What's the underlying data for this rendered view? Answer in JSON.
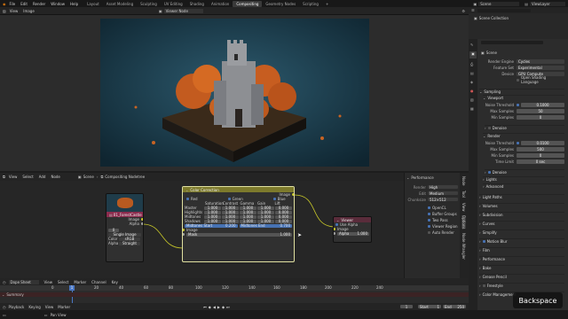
{
  "topbar": {
    "menus": [
      "File",
      "Edit",
      "Render",
      "Window",
      "Help"
    ],
    "workspaces": [
      "Layout",
      "Asset Modeling",
      "Sculpting",
      "UV Editing",
      "Shading",
      "Animation",
      "Compositing",
      "Geometry Nodes",
      "Scripting"
    ],
    "active_workspace": "Compositing",
    "scene": "Scene",
    "view_layer": "ViewLayer"
  },
  "viewer": {
    "menus": [
      "View",
      "Image"
    ],
    "image_name": "Viewer Node"
  },
  "node_editor": {
    "breadcrumb_scene": "Scene",
    "breadcrumb_tree": "Compositing Nodetree",
    "menus": [
      "View",
      "Select",
      "Add",
      "Node"
    ],
    "image_node": {
      "filename": "01_ForestCastle",
      "frame": "0",
      "source": "Single Image",
      "color_label": "Color",
      "color_value": "sRGB",
      "alpha_label": "Alpha",
      "alpha_value": "Straight",
      "out_image": "Image",
      "out_alpha": "Alpha"
    },
    "cc_node": {
      "title": "Color Correction",
      "channels": [
        "Red",
        "Green",
        "Blue"
      ],
      "columns": [
        "Saturation",
        "Contrast",
        "Gamma",
        "Gain",
        "Lift"
      ],
      "rows": [
        {
          "label": "Master",
          "values": [
            "1.000",
            "1.000",
            "1.000",
            "1.000",
            "0.000"
          ]
        },
        {
          "label": "Highlights",
          "values": [
            "1.000",
            "1.000",
            "1.000",
            "1.000",
            "0.000"
          ]
        },
        {
          "label": "Midtones",
          "values": [
            "1.000",
            "1.000",
            "1.000",
            "1.000",
            "0.000"
          ]
        },
        {
          "label": "Shadows",
          "values": [
            "1.000",
            "1.000",
            "1.000",
            "1.000",
            "0.000"
          ]
        }
      ],
      "midtones_start": "Midtones Start",
      "midtones_start_value": "0.200",
      "midtones_end": "Midtones End",
      "midtones_end_value": "0.700",
      "out_image": "Image",
      "in_image": "Image",
      "in_mask": "Mask",
      "mask_value": "1.000"
    },
    "viewer_node": {
      "title": "Viewer",
      "use_alpha": "Use Alpha",
      "in_image": "Image",
      "in_alpha": "Alpha",
      "alpha_value": "1.000"
    },
    "performance": {
      "title": "Performance",
      "render_label": "Render",
      "render_value": "High",
      "edit_label": "Edit",
      "edit_value": "Medium",
      "chunksize_label": "Chunksize",
      "chunksize_value": "512×512",
      "options": [
        "OpenCL",
        "Buffer Groups",
        "Two Pass",
        "Viewer Region",
        "Auto Render"
      ]
    },
    "tabs": [
      "Node",
      "Tool",
      "View",
      "Options",
      "Node Wrangler"
    ]
  },
  "timeline": {
    "editor": "Dope Sheet",
    "menus": [
      "View",
      "Select",
      "Marker",
      "Channel",
      "Key"
    ],
    "current_frame": "1",
    "ticks": [
      "0",
      "20",
      "40",
      "60",
      "80",
      "100",
      "120",
      "140",
      "160",
      "180",
      "200",
      "220",
      "240"
    ],
    "summary": "Summary",
    "playback": "Playback",
    "keying": "Keying",
    "view": "View",
    "marker": "Marker",
    "start_label": "Start",
    "start_value": "1",
    "end_label": "End",
    "end_value": "250",
    "frame_value": "1"
  },
  "status": {
    "left": "Pan View"
  },
  "outliner": {
    "title": "Scene Collection"
  },
  "properties": {
    "scene_name": "Scene",
    "render_engine_label": "Render Engine",
    "render_engine": "Cycles",
    "feature_set_label": "Feature Set",
    "feature_set": "Experimental",
    "device_label": "Device",
    "device": "GPU Compute",
    "osl": "Open Shading Language",
    "sampling": "Sampling",
    "viewport": "Viewport",
    "noise_threshold_label": "Noise Threshold",
    "vp_noise": "0.1000",
    "max_samples_label": "Max Samples",
    "vp_max": "50",
    "min_samples_label": "Min Samples",
    "vp_min": "0",
    "denoise": "Denoise",
    "render": "Render",
    "r_noise": "0.0100",
    "r_max": "500",
    "r_min": "0",
    "time_limit_label": "Time Limit",
    "r_time": "0 sec",
    "sections_small": [
      "Denoise",
      "Lights",
      "Advanced"
    ],
    "sections": [
      "Light Paths",
      "Volumes",
      "Subdivision",
      "Curves",
      "Simplify",
      "Motion Blur",
      "Film",
      "Performance",
      "Bake",
      "Grease Pencil",
      "Freestyle",
      "Color Management"
    ]
  },
  "overlay": {
    "key_hint": "Backspace"
  },
  "colors": {
    "accent": "#4772b3",
    "cc_header": "#7d7a2c",
    "image_node_header": "#8b2b4d",
    "viewer_header": "#5a2c3b",
    "playhead": "#4a77c4"
  }
}
